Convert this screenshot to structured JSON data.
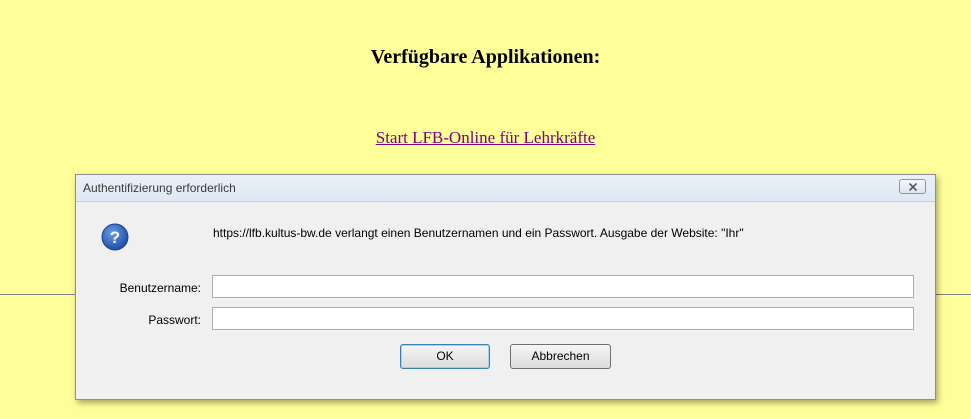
{
  "page": {
    "heading": "Verfügbare Applikationen:",
    "app_link": "Start LFB-Online für Lehrkräfte"
  },
  "dialog": {
    "title": "Authentifizierung erforderlich",
    "icon": "question-icon",
    "message": "https://lfb.kultus-bw.de verlangt einen Benutzernamen und ein Passwort. Ausgabe der Website: \"Ihr\"",
    "username_label": "Benutzername:",
    "username_value": "",
    "password_label": "Passwort:",
    "password_value": "",
    "ok_label": "OK",
    "cancel_label": "Abbrechen"
  },
  "colors": {
    "page_background": "#ffff99",
    "link": "#800080",
    "dialog_background": "#f0f0f0",
    "question_icon": "#2a5db0"
  }
}
